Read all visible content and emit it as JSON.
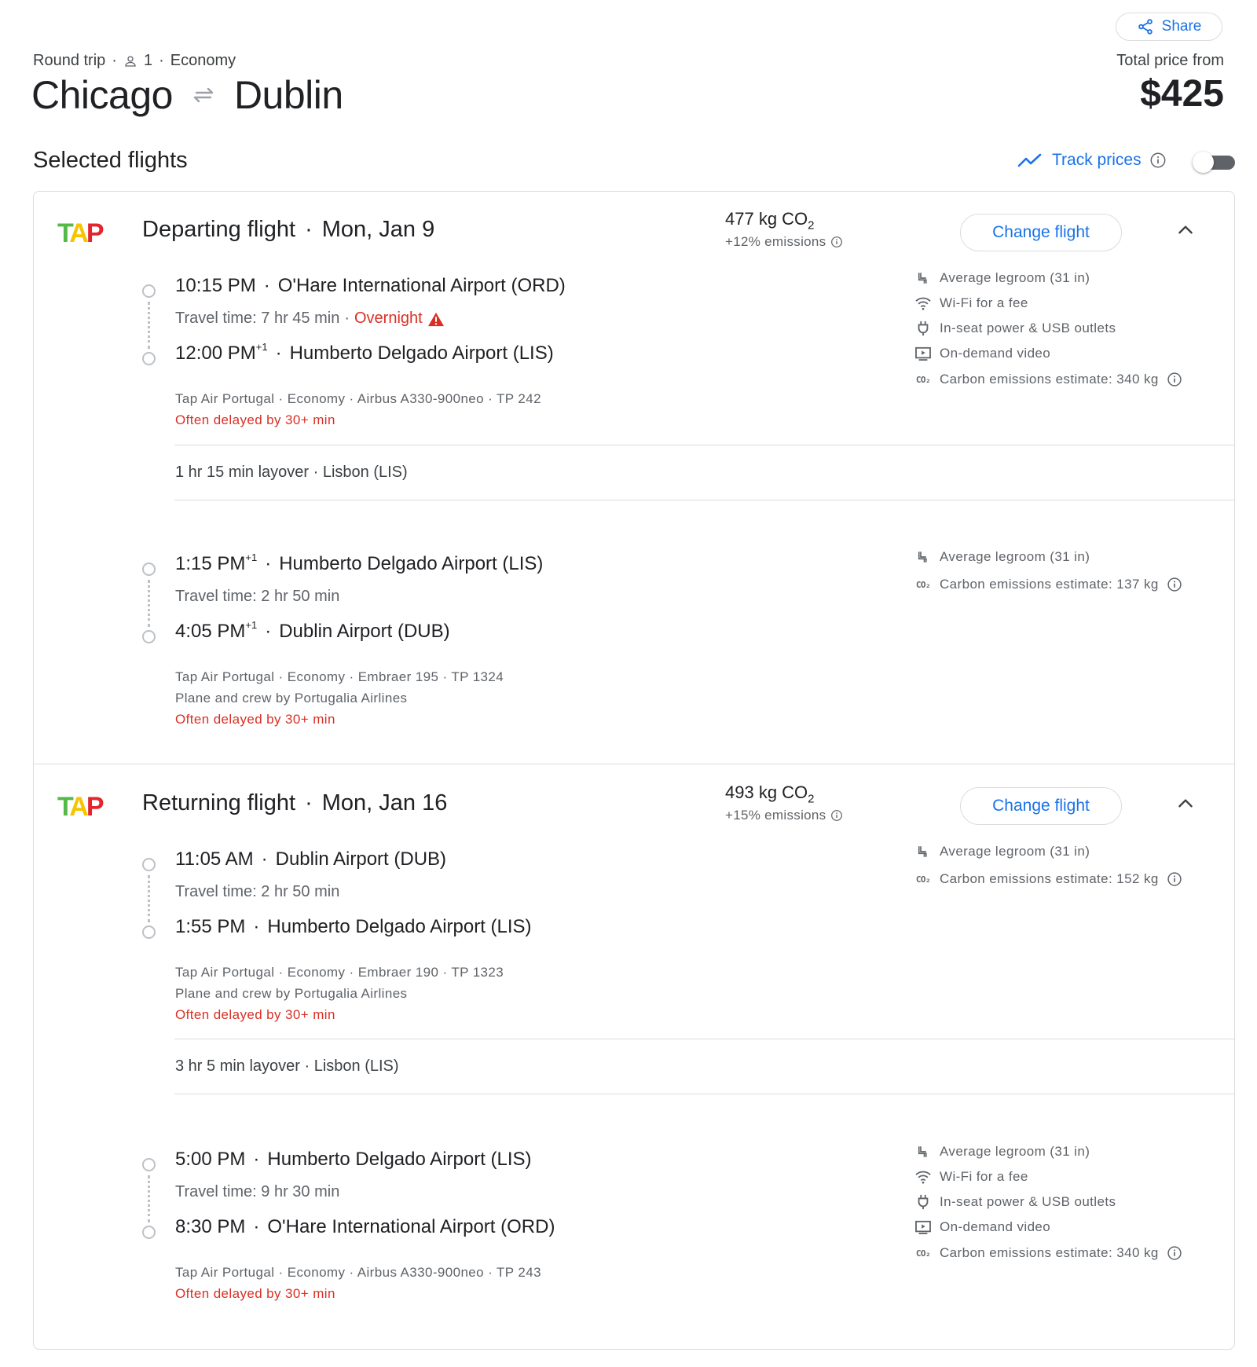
{
  "header": {
    "share_label": "Share",
    "trip_type": "Round trip",
    "passengers": "1",
    "cabin": "Economy",
    "origin": "Chicago",
    "destination": "Dublin",
    "price_label": "Total price from",
    "price": "$425"
  },
  "section_title": "Selected flights",
  "track_prices_label": "Track prices",
  "track_prices_enabled": false,
  "departing": {
    "title": "Departing flight",
    "date": "Mon, Jan 9",
    "co2": "477 kg CO",
    "co2_sub": "2",
    "emissions_delta": "+12% emissions",
    "change_label": "Change flight",
    "segments": [
      {
        "dep_time": "10:15 PM",
        "dep_plus": "",
        "dep_airport": "O'Hare International Airport (ORD)",
        "travel_time": "Travel time: 7 hr 45 min",
        "overnight": "Overnight",
        "arr_time": "12:00 PM",
        "arr_plus": "+1",
        "arr_airport": "Humberto Delgado Airport (LIS)",
        "details": "Tap Air Portugal · Economy · Airbus A330-900neo · TP 242",
        "operator": "",
        "delay": "Often delayed by 30+ min",
        "amenities": [
          "Average legroom (31 in)",
          "Wi-Fi for a fee",
          "In-seat power & USB outlets",
          "On-demand video",
          "Carbon emissions estimate: 340 kg"
        ]
      },
      {
        "dep_time": "1:15 PM",
        "dep_plus": "+1",
        "dep_airport": "Humberto Delgado Airport (LIS)",
        "travel_time": "Travel time: 2 hr 50 min",
        "arr_time": "4:05 PM",
        "arr_plus": "+1",
        "arr_airport": "Dublin Airport (DUB)",
        "details": "Tap Air Portugal · Economy · Embraer 195 · TP 1324",
        "operator": "Plane and crew by Portugalia Airlines",
        "delay": "Often delayed by 30+ min",
        "amenities": [
          "Average legroom (31 in)",
          "Carbon emissions estimate: 137 kg"
        ]
      }
    ],
    "layover": "1 hr 15 min layover · Lisbon (LIS)"
  },
  "returning": {
    "title": "Returning flight",
    "date": "Mon, Jan 16",
    "co2": "493 kg CO",
    "co2_sub": "2",
    "emissions_delta": "+15% emissions",
    "change_label": "Change flight",
    "segments": [
      {
        "dep_time": "11:05 AM",
        "dep_airport": "Dublin Airport (DUB)",
        "travel_time": "Travel time: 2 hr 50 min",
        "arr_time": "1:55 PM",
        "arr_airport": "Humberto Delgado Airport (LIS)",
        "details": "Tap Air Portugal · Economy · Embraer 190 · TP 1323",
        "operator": "Plane and crew by Portugalia Airlines",
        "delay": "Often delayed by 30+ min",
        "amenities": [
          "Average legroom (31 in)",
          "Carbon emissions estimate: 152 kg"
        ]
      },
      {
        "dep_time": "5:00 PM",
        "dep_airport": "Humberto Delgado Airport (LIS)",
        "travel_time": "Travel time: 9 hr 30 min",
        "arr_time": "8:30 PM",
        "arr_airport": "O'Hare International Airport (ORD)",
        "details": "Tap Air Portugal · Economy · Airbus A330-900neo · TP 243",
        "delay": "Often delayed by 30+ min",
        "amenities": [
          "Average legroom (31 in)",
          "Wi-Fi for a fee",
          "In-seat power & USB outlets",
          "On-demand video",
          "Carbon emissions estimate: 340 kg"
        ]
      }
    ],
    "layover": "3 hr 5 min layover · Lisbon (LIS)"
  },
  "colors": {
    "accent": "#1a73e8",
    "warning": "#d93025",
    "tap_green": "#55b948",
    "tap_yellow": "#f6c500",
    "tap_red": "#e3262e"
  }
}
